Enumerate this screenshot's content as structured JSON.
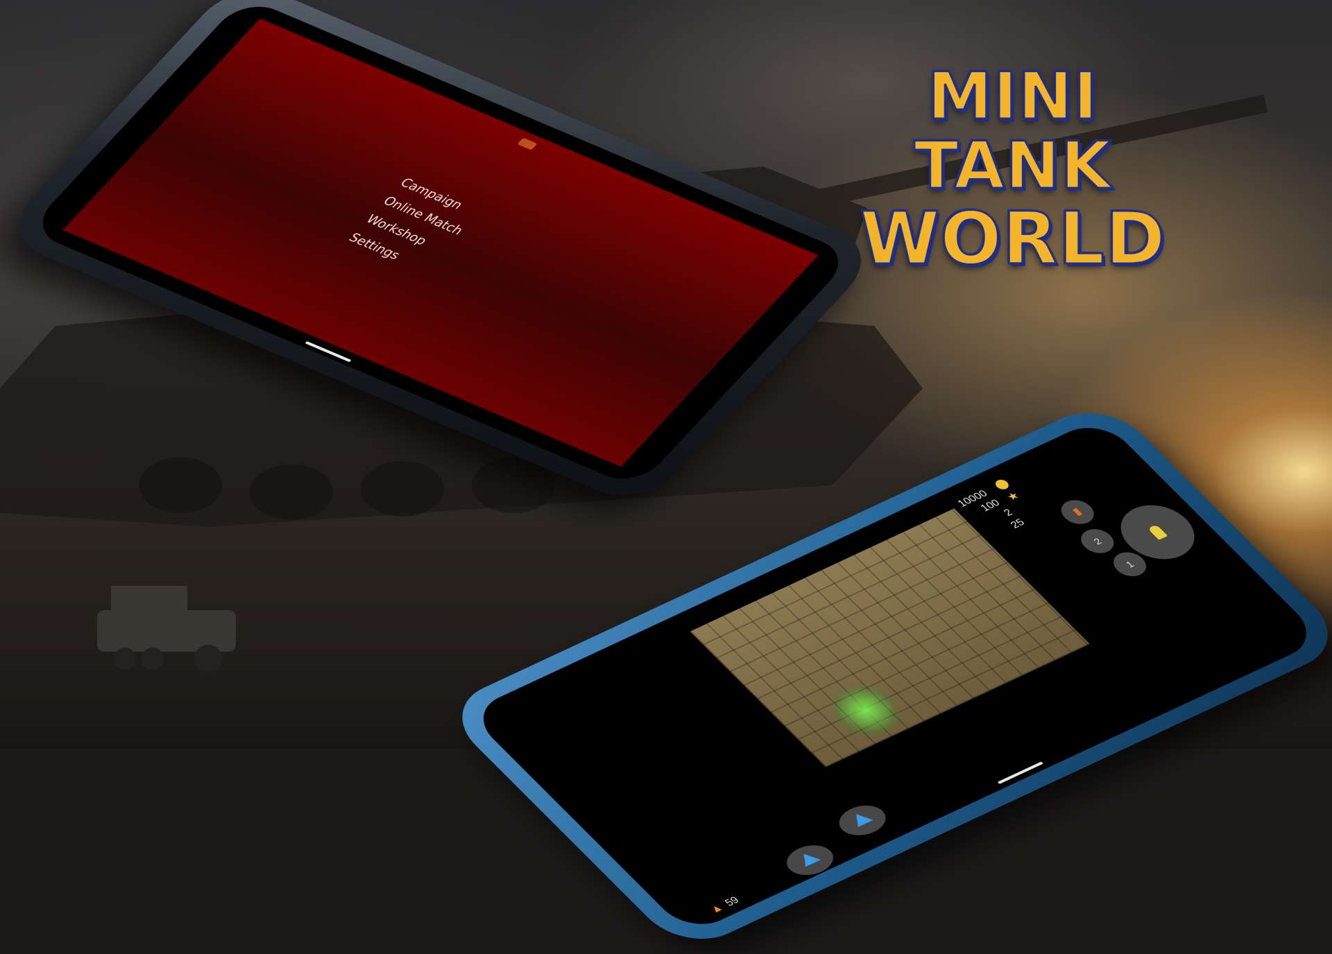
{
  "logo": {
    "line1": "MINI TANK",
    "line2": "WORLD"
  },
  "menu_screen": {
    "items": [
      {
        "label": "Campaign"
      },
      {
        "label": "Online Match"
      },
      {
        "label": "Workshop"
      },
      {
        "label": "Settings"
      }
    ]
  },
  "game_screen": {
    "hud": {
      "coins": "10000",
      "stat_a": "100",
      "stat_b": "2",
      "stat_c": "25",
      "fuel": "59"
    },
    "controls": {
      "fire_count": "2",
      "special_count": "1"
    }
  },
  "colors": {
    "logo_fill": "#f5b52a",
    "logo_outline": "#1f2f86",
    "menu_bg": "#7d0000",
    "phone2_frame": "#2f6fa3"
  },
  "icons": [
    "tank-icon",
    "coin-icon",
    "star-icon",
    "fuel-icon",
    "fire-button-icon",
    "arrow-up-icon"
  ]
}
